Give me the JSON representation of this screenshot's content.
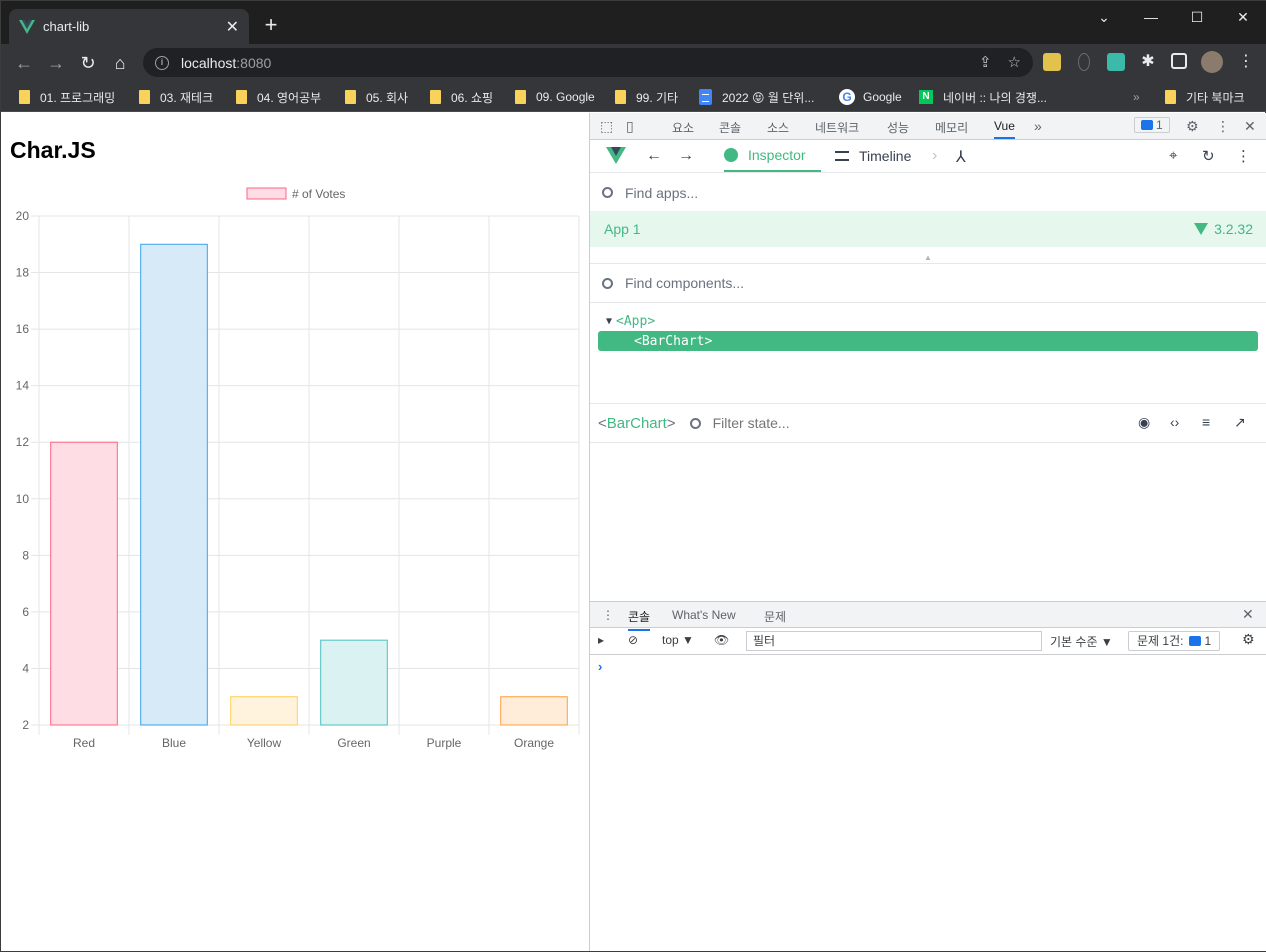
{
  "browser": {
    "tab_title": "chart-lib",
    "url_host": "localhost",
    "url_port": ":8080",
    "bookmarks": [
      "01. 프로그래밍",
      "03. 재테크",
      "04. 영어공부",
      "05. 회사",
      "06. 쇼핑",
      "09. Google",
      "99. 기타",
      "2022 😝 월 단위...",
      "Google",
      "네이버 :: 나의 경쟁...",
      "기타 북마크"
    ]
  },
  "page": {
    "title": "Char.JS"
  },
  "chart_data": {
    "type": "bar",
    "categories": [
      "Red",
      "Blue",
      "Yellow",
      "Green",
      "Purple",
      "Orange"
    ],
    "series": [
      {
        "name": "# of Votes",
        "values": [
          12,
          19,
          3,
          5,
          2,
          3
        ]
      }
    ],
    "fill_colors": [
      "#ffdde4",
      "#d6eaf8",
      "#fff3dd",
      "#dbf2f2",
      "#ebe0ff",
      "#ffecd9"
    ],
    "border_colors": [
      "#ff6384",
      "#36a2eb",
      "#ffce56",
      "#4bc0c0",
      "#9966ff",
      "#ff9f40"
    ],
    "ylim": [
      2,
      20
    ],
    "yticks": [
      2,
      4,
      6,
      8,
      10,
      12,
      14,
      16,
      18,
      20
    ],
    "legend_position": "top",
    "grid": true
  },
  "devtools": {
    "tabs": [
      "요소",
      "콘솔",
      "소스",
      "네트워크",
      "성능",
      "메모리",
      "Vue"
    ],
    "issue_count": "1",
    "vue": {
      "inspector_label": "Inspector",
      "timeline_label": "Timeline",
      "find_apps_placeholder": "Find apps...",
      "app_name": "App 1",
      "vue_version": "3.2.32",
      "find_components_placeholder": "Find components...",
      "tree_root": "<App>",
      "tree_child": "<BarChart>",
      "selected_component_open": "<",
      "selected_component_name": "BarChart",
      "selected_component_close": ">",
      "filter_state_placeholder": "Filter state..."
    },
    "drawer": {
      "tabs": [
        "콘솔",
        "What's New",
        "문제"
      ],
      "context": "top",
      "filter_placeholder": "필터",
      "levels": "기본 수준",
      "issues_label": "문제 1건:",
      "issues_count": "1"
    }
  }
}
